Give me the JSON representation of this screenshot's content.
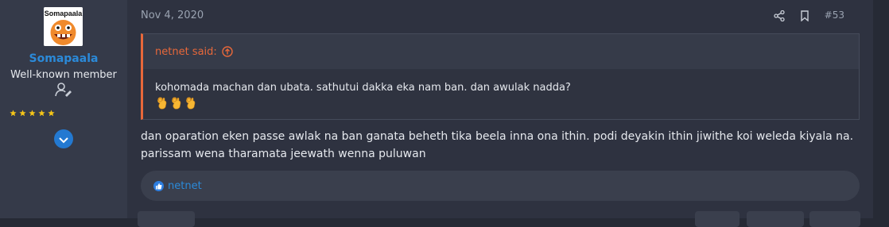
{
  "user": {
    "name": "Somapaala",
    "title": "Well-known member",
    "avatar_text": "Somapaala",
    "star_count": 5,
    "colors": {
      "name": "#2b8ad9",
      "stars": "#f5c518",
      "avatar_face": "#f08a2c"
    }
  },
  "post": {
    "date": "Nov 4, 2020",
    "number": "#53",
    "icons": [
      "share-icon",
      "bookmark-icon"
    ],
    "body": "dan oparation eken passe awlak na ban ganata beheth tika beela inna ona ithin. podi deyakin ithin jiwithe koi weleda kiyala na. parissam wena tharamata jeewath wenna puluwan"
  },
  "quote": {
    "author_said": "netnet said:",
    "text": "kohomada machan dan ubata. sathutui dakka eka nam ban. dan awulak nadda?",
    "emojis": [
      "ok-hand-emoji",
      "ok-hand-emoji",
      "ok-hand-emoji"
    ],
    "accent": "#e8683a"
  },
  "reactions": {
    "icon": "like-icon",
    "user": "netnet"
  }
}
